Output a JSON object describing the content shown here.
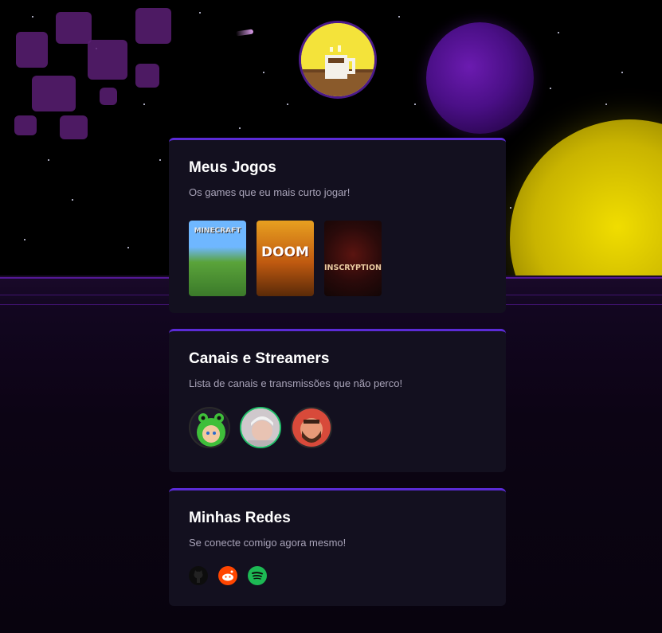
{
  "profile": {
    "avatar_alt": "coffee-cup-pixel-avatar"
  },
  "games_card": {
    "title": "Meus Jogos",
    "subtitle": "Os games que eu mais curto jogar!",
    "games": [
      {
        "label": "MINECRAFT",
        "icon": "minecraft-cover"
      },
      {
        "label": "DOOM",
        "icon": "doom-cover"
      },
      {
        "label": "INSCRYPTION",
        "icon": "inscryption-cover"
      }
    ]
  },
  "streamers_card": {
    "title": "Canais e Streamers",
    "subtitle": "Lista de canais e transmissões que não perco!",
    "streamers": [
      {
        "icon": "streamer-frog-hood-avatar"
      },
      {
        "icon": "streamer-white-hair-avatar"
      },
      {
        "icon": "streamer-bearded-avatar"
      }
    ]
  },
  "socials_card": {
    "title": "Minhas Redes",
    "subtitle": "Se conecte comigo agora mesmo!",
    "links": [
      {
        "icon": "github-icon",
        "color": "#111111"
      },
      {
        "icon": "reddit-icon",
        "color": "#ff4500"
      },
      {
        "icon": "spotify-icon",
        "color": "#1db954"
      }
    ]
  },
  "colors": {
    "accent": "#5b2bd6",
    "card_bg": "#13101f",
    "planet_purple": "#4a0f86",
    "planet_yellow": "#e6d200"
  }
}
